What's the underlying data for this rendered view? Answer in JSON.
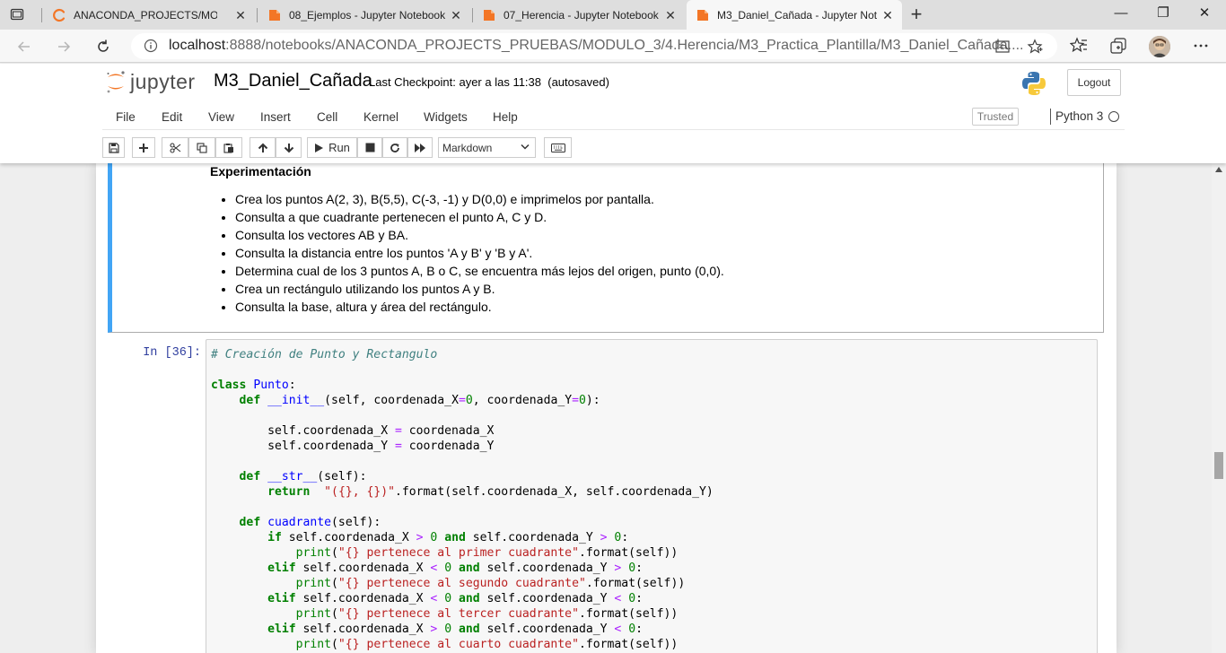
{
  "browser": {
    "tabs": [
      {
        "title": "ANACONDA_PROJECTS/MODULO",
        "favicon": "anaconda-icon",
        "active": false
      },
      {
        "title": "08_Ejemplos - Jupyter Notebook",
        "favicon": "jupyter-notebook-icon",
        "active": false
      },
      {
        "title": "07_Herencia - Jupyter Notebook",
        "favicon": "jupyter-notebook-icon",
        "active": false
      },
      {
        "title": "M3_Daniel_Cañada - Jupyter Not",
        "favicon": "jupyter-notebook-icon",
        "active": true
      }
    ],
    "tab_close_glyph": "✕",
    "new_tab_glyph": "+",
    "window_controls": {
      "minimize": "—",
      "maximize": "❐",
      "close": "✕"
    },
    "url_host": "localhost",
    "url_rest": ":8888/notebooks/ANACONDA_PROJECTS_PRUEBAS/MODULO_3/4.Herencia/M3_Practica_Plantilla/M3_Daniel_Cañada....",
    "icons": [
      "back-icon",
      "forward-icon",
      "refresh-icon",
      "info-icon",
      "reader-mode-icon",
      "add-favorite-icon",
      "favorites-icon",
      "collections-icon",
      "profile-avatar",
      "more-icon"
    ],
    "colors": {
      "accent": "#f37626",
      "tabbar": "#dedede"
    }
  },
  "jupyter": {
    "logo_text": "jupyter",
    "notebook_name": "M3_Daniel_Cañada",
    "checkpoint_label": "Last Checkpoint:",
    "checkpoint_time": "ayer a las 11:38",
    "autosave_status": "(autosaved)",
    "logout_label": "Logout",
    "menu": [
      "File",
      "Edit",
      "View",
      "Insert",
      "Cell",
      "Kernel",
      "Widgets",
      "Help"
    ],
    "trusted_label": "Trusted",
    "kernel_name": "Python 3",
    "toolbar": {
      "run_label": "Run",
      "cell_type": "Markdown",
      "buttons": [
        "save-icon",
        "add-cell-icon",
        "cut-icon",
        "copy-icon",
        "paste-icon",
        "move-up-icon",
        "move-down-icon",
        "run-icon",
        "stop-icon",
        "restart-icon",
        "fast-forward-icon",
        "keyboard-icon"
      ]
    },
    "colors": {
      "selected_cell": "#42a5f5",
      "prompt": "#303f9f"
    }
  },
  "markdown_cell": {
    "heading": "Experimentación",
    "items": [
      "Crea los puntos A(2, 3), B(5,5), C(-3, -1) y D(0,0) e imprimelos por pantalla.",
      "Consulta a que cuadrante pertenecen el punto A, C y D.",
      "Consulta los vectores AB y BA.",
      "Consulta la distancia entre los puntos 'A y B' y 'B y A'.",
      "Determina cual de los 3 puntos A, B o C, se encuentra más lejos del origen, punto (0,0).",
      "Crea un rectángulo utilizando los puntos A y B.",
      "Consulta la base, altura y área del rectángulo."
    ]
  },
  "code_cell": {
    "prompt": "In [36]:",
    "lines": [
      [
        [
          "com",
          "# Creación de Punto y Rectangulo"
        ]
      ],
      [],
      [
        [
          "kw",
          "class"
        ],
        [
          "",
          " "
        ],
        [
          "def",
          "Punto"
        ],
        [
          "",
          ":"
        ]
      ],
      [
        [
          "",
          "    "
        ],
        [
          "kw",
          "def"
        ],
        [
          "",
          " "
        ],
        [
          "def",
          "__init__"
        ],
        [
          "",
          "(self, coordenada_X"
        ],
        [
          "op",
          "="
        ],
        [
          "num",
          "0"
        ],
        [
          "",
          ", coordenada_Y"
        ],
        [
          "op",
          "="
        ],
        [
          "num",
          "0"
        ],
        [
          "",
          "):"
        ]
      ],
      [],
      [
        [
          "",
          "        self.coordenada_X "
        ],
        [
          "op",
          "="
        ],
        [
          "",
          " coordenada_X"
        ]
      ],
      [
        [
          "",
          "        self.coordenada_Y "
        ],
        [
          "op",
          "="
        ],
        [
          "",
          " coordenada_Y"
        ]
      ],
      [],
      [
        [
          "",
          "    "
        ],
        [
          "kw",
          "def"
        ],
        [
          "",
          " "
        ],
        [
          "def",
          "__str__"
        ],
        [
          "",
          "(self):"
        ]
      ],
      [
        [
          "",
          "        "
        ],
        [
          "kw",
          "return"
        ],
        [
          "",
          "  "
        ],
        [
          "str",
          "\"({}, {})\""
        ],
        [
          "",
          ".format(self.coordenada_X, self.coordenada_Y)"
        ]
      ],
      [],
      [
        [
          "",
          "    "
        ],
        [
          "kw",
          "def"
        ],
        [
          "",
          " "
        ],
        [
          "def",
          "cuadrante"
        ],
        [
          "",
          "(self):"
        ]
      ],
      [
        [
          "",
          "        "
        ],
        [
          "kw",
          "if"
        ],
        [
          "",
          " self.coordenada_X "
        ],
        [
          "op",
          ">"
        ],
        [
          "",
          " "
        ],
        [
          "num",
          "0"
        ],
        [
          "",
          " "
        ],
        [
          "kw",
          "and"
        ],
        [
          "",
          " self.coordenada_Y "
        ],
        [
          "op",
          ">"
        ],
        [
          "",
          " "
        ],
        [
          "num",
          "0"
        ],
        [
          "",
          ":"
        ]
      ],
      [
        [
          "",
          "            "
        ],
        [
          "bi",
          "print"
        ],
        [
          "",
          "("
        ],
        [
          "str",
          "\"{} pertenece al primer cuadrante\""
        ],
        [
          "",
          ".format(self))"
        ]
      ],
      [
        [
          "",
          "        "
        ],
        [
          "kw",
          "elif"
        ],
        [
          "",
          " self.coordenada_X "
        ],
        [
          "op",
          "<"
        ],
        [
          "",
          " "
        ],
        [
          "num",
          "0"
        ],
        [
          "",
          " "
        ],
        [
          "kw",
          "and"
        ],
        [
          "",
          " self.coordenada_Y "
        ],
        [
          "op",
          ">"
        ],
        [
          "",
          " "
        ],
        [
          "num",
          "0"
        ],
        [
          "",
          ":"
        ]
      ],
      [
        [
          "",
          "            "
        ],
        [
          "bi",
          "print"
        ],
        [
          "",
          "("
        ],
        [
          "str",
          "\"{} pertenece al segundo cuadrante\""
        ],
        [
          "",
          ".format(self))"
        ]
      ],
      [
        [
          "",
          "        "
        ],
        [
          "kw",
          "elif"
        ],
        [
          "",
          " self.coordenada_X "
        ],
        [
          "op",
          "<"
        ],
        [
          "",
          " "
        ],
        [
          "num",
          "0"
        ],
        [
          "",
          " "
        ],
        [
          "kw",
          "and"
        ],
        [
          "",
          " self.coordenada_Y "
        ],
        [
          "op",
          "<"
        ],
        [
          "",
          " "
        ],
        [
          "num",
          "0"
        ],
        [
          "",
          ":"
        ]
      ],
      [
        [
          "",
          "            "
        ],
        [
          "bi",
          "print"
        ],
        [
          "",
          "("
        ],
        [
          "str",
          "\"{} pertenece al tercer cuadrante\""
        ],
        [
          "",
          ".format(self))"
        ]
      ],
      [
        [
          "",
          "        "
        ],
        [
          "kw",
          "elif"
        ],
        [
          "",
          " self.coordenada_X "
        ],
        [
          "op",
          ">"
        ],
        [
          "",
          " "
        ],
        [
          "num",
          "0"
        ],
        [
          "",
          " "
        ],
        [
          "kw",
          "and"
        ],
        [
          "",
          " self.coordenada_Y "
        ],
        [
          "op",
          "<"
        ],
        [
          "",
          " "
        ],
        [
          "num",
          "0"
        ],
        [
          "",
          ":"
        ]
      ],
      [
        [
          "",
          "            "
        ],
        [
          "bi",
          "print"
        ],
        [
          "",
          "("
        ],
        [
          "str",
          "\"{} pertenece al cuarto cuadrante\""
        ],
        [
          "",
          ".format(self))"
        ]
      ]
    ]
  }
}
